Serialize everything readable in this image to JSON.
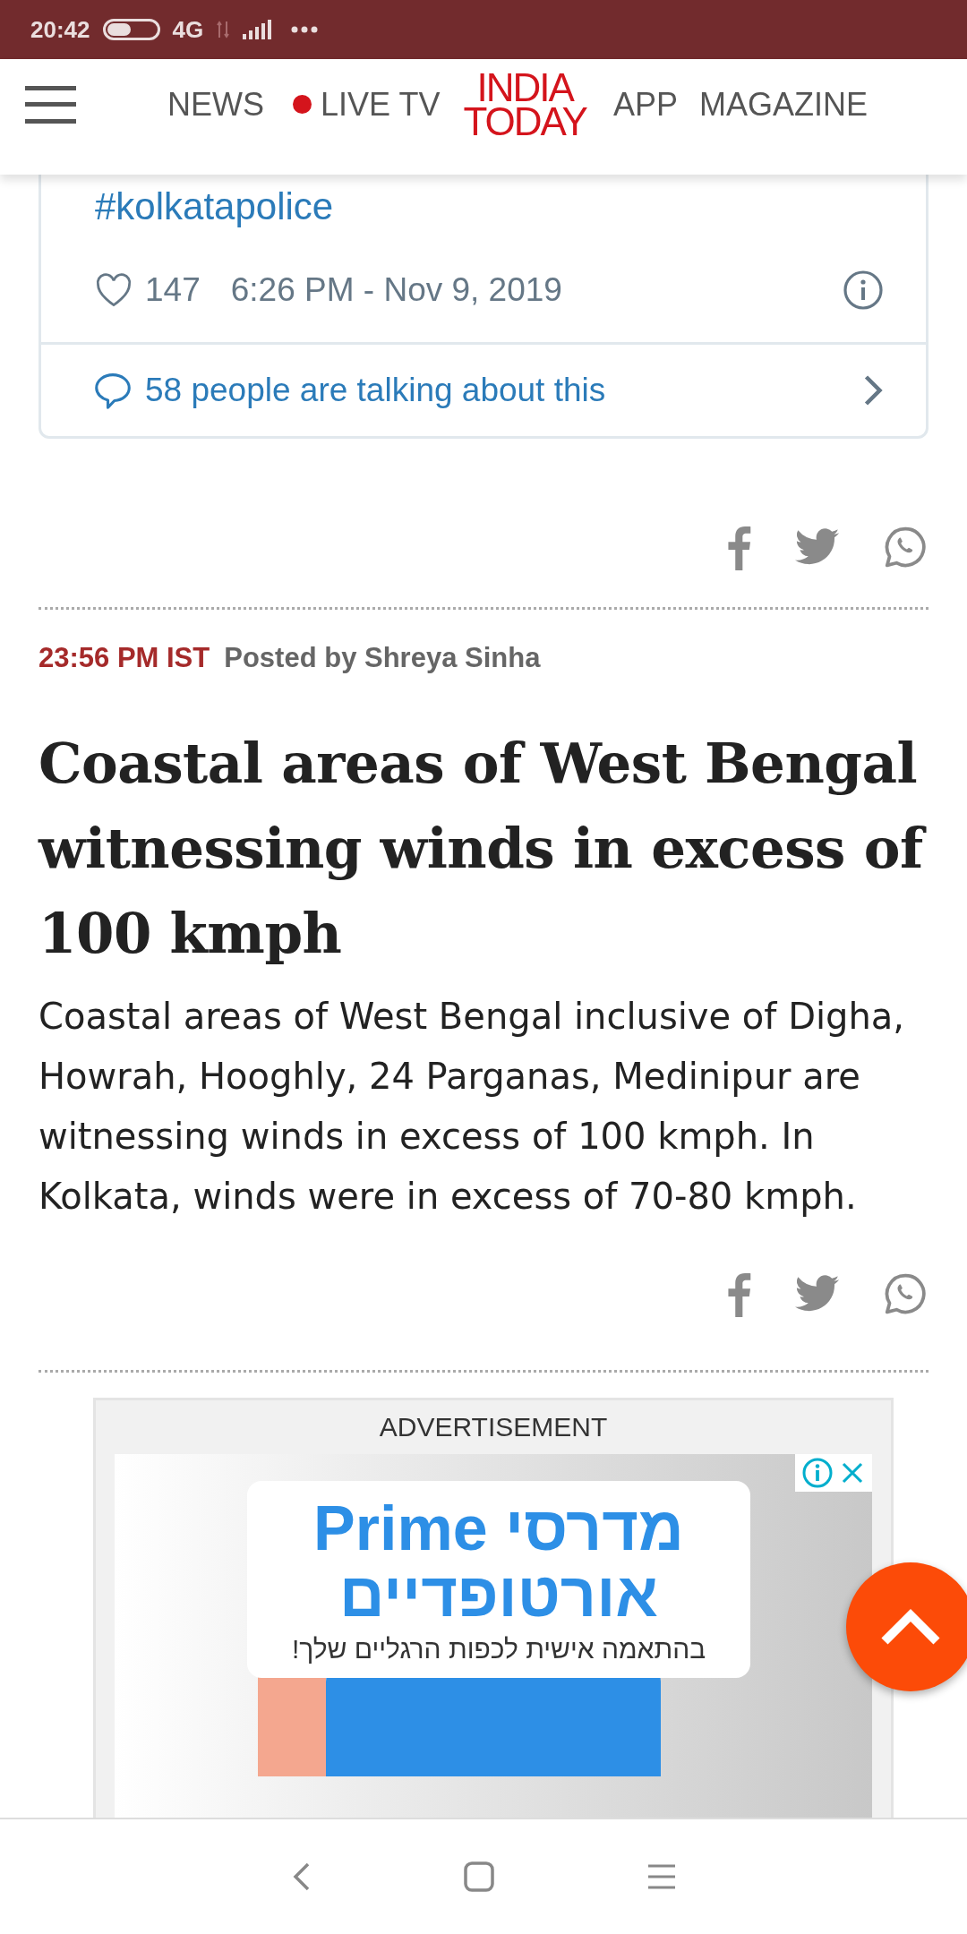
{
  "status_bar": {
    "time": "20:42",
    "network": "4G"
  },
  "header": {
    "nav_left": [
      "NEWS",
      "LIVE TV"
    ],
    "logo": [
      "INDIA",
      "TODAY"
    ],
    "nav_right": [
      "APP",
      "MAGAZINE"
    ]
  },
  "tweet": {
    "hashtag": "#kolkatapolice",
    "likes": "147",
    "timestamp": "6:26 PM - Nov 9, 2019",
    "discussion": "58 people are talking about this"
  },
  "post": {
    "time": "23:56 PM IST",
    "byline": "Posted by Shreya Sinha",
    "headline": "Coastal areas of West Bengal witnessing winds in excess of 100 kmph",
    "body": "Coastal areas of West Bengal inclusive of Digha, Howrah, Hooghly, 24 Parganas, Medinipur are witnessing winds in excess of 100 kmph. In Kolkata, winds were in excess of 70-80 kmph."
  },
  "advertisement": {
    "label": "ADVERTISEMENT",
    "lines": [
      "מדרסי Prime",
      "אורטופדיים",
      "בהתאמה אישית לכפות הרגליים שלך!"
    ]
  }
}
